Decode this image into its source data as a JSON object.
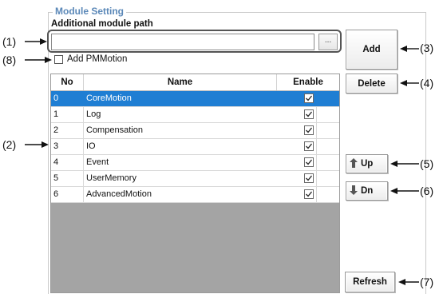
{
  "group": {
    "title": "Module Setting"
  },
  "path": {
    "label": "Additional module path",
    "value": "",
    "browse_label": "..."
  },
  "pm_motion": {
    "label": "Add PMMotion",
    "checked": false
  },
  "table": {
    "headers": {
      "no": "No",
      "name": "Name",
      "enable": "Enable"
    },
    "rows": [
      {
        "no": "0",
        "name": "CoreMotion",
        "enabled": true,
        "selected": true
      },
      {
        "no": "1",
        "name": "Log",
        "enabled": true,
        "selected": false
      },
      {
        "no": "2",
        "name": "Compensation",
        "enabled": true,
        "selected": false
      },
      {
        "no": "3",
        "name": "IO",
        "enabled": true,
        "selected": false
      },
      {
        "no": "4",
        "name": "Event",
        "enabled": true,
        "selected": false
      },
      {
        "no": "5",
        "name": "UserMemory",
        "enabled": true,
        "selected": false
      },
      {
        "no": "6",
        "name": "AdvancedMotion",
        "enabled": true,
        "selected": false
      }
    ]
  },
  "buttons": {
    "add": "Add",
    "delete": "Delete",
    "up": "Up",
    "down": "Dn",
    "refresh": "Refresh"
  },
  "callouts": {
    "c1": "(1)",
    "c2": "(2)",
    "c3": "(3)",
    "c4": "(4)",
    "c5": "(5)",
    "c6": "(6)",
    "c7": "(7)",
    "c8": "(8)"
  },
  "colors": {
    "title": "#5b88b8",
    "selected_row": "#1f7ed3",
    "grid_background": "#a4a4a4"
  }
}
